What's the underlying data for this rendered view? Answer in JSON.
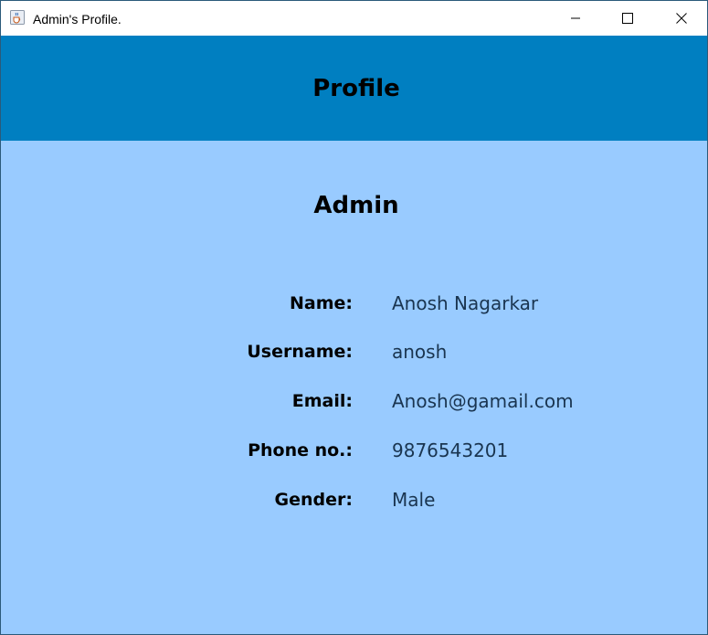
{
  "window": {
    "title": "Admin's Profile.",
    "icon": "java-cup-icon"
  },
  "header": {
    "title": "Profile"
  },
  "profile": {
    "role": "Admin",
    "fields": [
      {
        "label": "Name:",
        "value": "Anosh Nagarkar"
      },
      {
        "label": "Username:",
        "value": "anosh"
      },
      {
        "label": "Email:",
        "value": "Anosh@gamail.com"
      },
      {
        "label": "Phone no.:",
        "value": "9876543201"
      },
      {
        "label": "Gender:",
        "value": "Male"
      }
    ]
  },
  "colors": {
    "header_bg": "#007fc1",
    "body_bg": "#99cbff",
    "value_text": "#1a3550"
  }
}
